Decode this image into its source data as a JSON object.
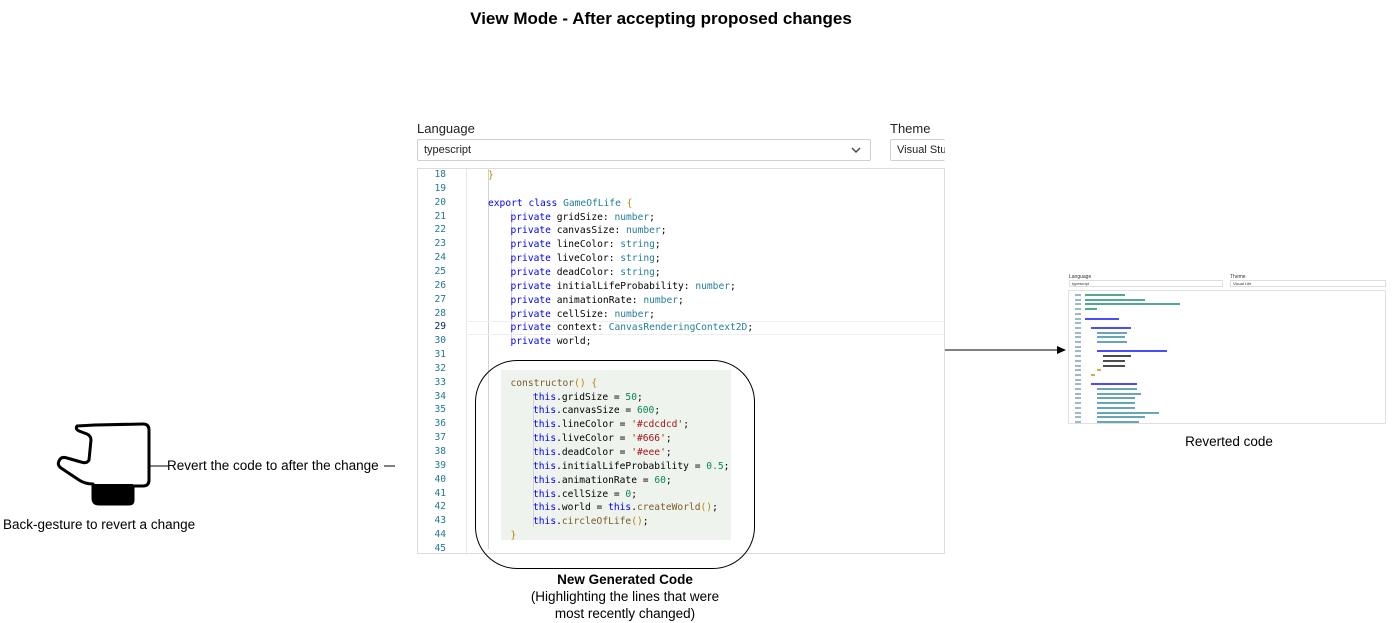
{
  "title": "View Mode - After accepting proposed changes",
  "editor_panel": {
    "language_label": "Language",
    "language_value": "typescript",
    "theme_label": "Theme",
    "theme_value": "Visual Stu",
    "current_line": 29,
    "code_lines": [
      {
        "n": 18,
        "indent": 1,
        "tokens": [
          [
            "brace",
            "}"
          ]
        ]
      },
      {
        "n": 19,
        "indent": 0,
        "tokens": []
      },
      {
        "n": 20,
        "indent": 1,
        "tokens": [
          [
            "kw",
            "export "
          ],
          [
            "kw",
            "class "
          ],
          [
            "cls",
            "GameOfLife "
          ],
          [
            "brace",
            "{"
          ]
        ]
      },
      {
        "n": 21,
        "indent": 2,
        "tokens": [
          [
            "kw",
            "private "
          ],
          [
            "txt",
            "gridSize: "
          ],
          [
            "type",
            "number"
          ],
          [
            "txt",
            ";"
          ]
        ]
      },
      {
        "n": 22,
        "indent": 2,
        "tokens": [
          [
            "kw",
            "private "
          ],
          [
            "txt",
            "canvasSize: "
          ],
          [
            "type",
            "number"
          ],
          [
            "txt",
            ";"
          ]
        ]
      },
      {
        "n": 23,
        "indent": 2,
        "tokens": [
          [
            "kw",
            "private "
          ],
          [
            "txt",
            "lineColor: "
          ],
          [
            "type",
            "string"
          ],
          [
            "txt",
            ";"
          ]
        ]
      },
      {
        "n": 24,
        "indent": 2,
        "tokens": [
          [
            "kw",
            "private "
          ],
          [
            "txt",
            "liveColor: "
          ],
          [
            "type",
            "string"
          ],
          [
            "txt",
            ";"
          ]
        ]
      },
      {
        "n": 25,
        "indent": 2,
        "tokens": [
          [
            "kw",
            "private "
          ],
          [
            "txt",
            "deadColor: "
          ],
          [
            "type",
            "string"
          ],
          [
            "txt",
            ";"
          ]
        ]
      },
      {
        "n": 26,
        "indent": 2,
        "tokens": [
          [
            "kw",
            "private "
          ],
          [
            "txt",
            "initialLifeProbability: "
          ],
          [
            "type",
            "number"
          ],
          [
            "txt",
            ";"
          ]
        ]
      },
      {
        "n": 27,
        "indent": 2,
        "tokens": [
          [
            "kw",
            "private "
          ],
          [
            "txt",
            "animationRate: "
          ],
          [
            "type",
            "number"
          ],
          [
            "txt",
            ";"
          ]
        ]
      },
      {
        "n": 28,
        "indent": 2,
        "tokens": [
          [
            "kw",
            "private "
          ],
          [
            "txt",
            "cellSize: "
          ],
          [
            "type",
            "number"
          ],
          [
            "txt",
            ";"
          ]
        ]
      },
      {
        "n": 29,
        "indent": 2,
        "tokens": [
          [
            "kw",
            "private "
          ],
          [
            "txt",
            "context: "
          ],
          [
            "cls",
            "CanvasRenderingContext2D"
          ],
          [
            "txt",
            ";"
          ]
        ]
      },
      {
        "n": 30,
        "indent": 2,
        "tokens": [
          [
            "kw",
            "private "
          ],
          [
            "txt",
            "world;"
          ]
        ]
      },
      {
        "n": 31,
        "indent": 0,
        "tokens": []
      },
      {
        "n": 32,
        "indent": 0,
        "tokens": []
      },
      {
        "n": 33,
        "indent": 2,
        "tokens": [
          [
            "fn",
            "constructor"
          ],
          [
            "brace",
            "() {"
          ]
        ]
      },
      {
        "n": 34,
        "indent": 3,
        "tokens": [
          [
            "kw",
            "this"
          ],
          [
            "txt",
            ".gridSize = "
          ],
          [
            "num",
            "50"
          ],
          [
            "txt",
            ";"
          ]
        ]
      },
      {
        "n": 35,
        "indent": 3,
        "tokens": [
          [
            "kw",
            "this"
          ],
          [
            "txt",
            ".canvasSize = "
          ],
          [
            "num",
            "600"
          ],
          [
            "txt",
            ";"
          ]
        ]
      },
      {
        "n": 36,
        "indent": 3,
        "tokens": [
          [
            "kw",
            "this"
          ],
          [
            "txt",
            ".lineColor = "
          ],
          [
            "str",
            "'#cdcdcd'"
          ],
          [
            "txt",
            ";"
          ]
        ]
      },
      {
        "n": 37,
        "indent": 3,
        "tokens": [
          [
            "kw",
            "this"
          ],
          [
            "txt",
            ".liveColor = "
          ],
          [
            "str",
            "'#666'"
          ],
          [
            "txt",
            ";"
          ]
        ]
      },
      {
        "n": 38,
        "indent": 3,
        "tokens": [
          [
            "kw",
            "this"
          ],
          [
            "txt",
            ".deadColor = "
          ],
          [
            "str",
            "'#eee'"
          ],
          [
            "txt",
            ";"
          ]
        ]
      },
      {
        "n": 39,
        "indent": 3,
        "tokens": [
          [
            "kw",
            "this"
          ],
          [
            "txt",
            ".initialLifeProbability = "
          ],
          [
            "num",
            "0.5"
          ],
          [
            "txt",
            ";"
          ]
        ]
      },
      {
        "n": 40,
        "indent": 3,
        "tokens": [
          [
            "kw",
            "this"
          ],
          [
            "txt",
            ".animationRate = "
          ],
          [
            "num",
            "60"
          ],
          [
            "txt",
            ";"
          ]
        ]
      },
      {
        "n": 41,
        "indent": 3,
        "tokens": [
          [
            "kw",
            "this"
          ],
          [
            "txt",
            ".cellSize = "
          ],
          [
            "num",
            "0"
          ],
          [
            "txt",
            ";"
          ]
        ]
      },
      {
        "n": 42,
        "indent": 3,
        "tokens": [
          [
            "kw",
            "this"
          ],
          [
            "txt",
            ".world = "
          ],
          [
            "kw",
            "this"
          ],
          [
            "txt",
            "."
          ],
          [
            "fn",
            "createWorld"
          ],
          [
            "brace",
            "()"
          ],
          [
            "txt",
            ";"
          ]
        ]
      },
      {
        "n": 43,
        "indent": 3,
        "tokens": [
          [
            "kw",
            "this"
          ],
          [
            "txt",
            "."
          ],
          [
            "fn",
            "circleOfLife"
          ],
          [
            "brace",
            "()"
          ],
          [
            "txt",
            ";"
          ]
        ]
      },
      {
        "n": 44,
        "indent": 2,
        "tokens": [
          [
            "brace",
            "}"
          ]
        ]
      },
      {
        "n": 45,
        "indent": 0,
        "tokens": []
      }
    ]
  },
  "highlight_caption": {
    "title": "New Generated Code",
    "line1": "(Highlighting the lines that were",
    "line2": "most recently changed)"
  },
  "gesture": {
    "icon": "hand-back-gesture-icon",
    "connector_label": "Revert the code to after the change",
    "caption": "Back-gesture to revert a change"
  },
  "thumbnail": {
    "language_label": "Language",
    "language_value": "typescript",
    "theme_label": "Theme",
    "theme_value": "Visual Lite",
    "caption": "Reverted code"
  },
  "colors": {
    "keyword": "#0000ff",
    "type": "#267f99",
    "string": "#a31515",
    "number": "#098658",
    "function": "#795e26",
    "line_number": "#237893",
    "highlight": "#eef3ee"
  }
}
